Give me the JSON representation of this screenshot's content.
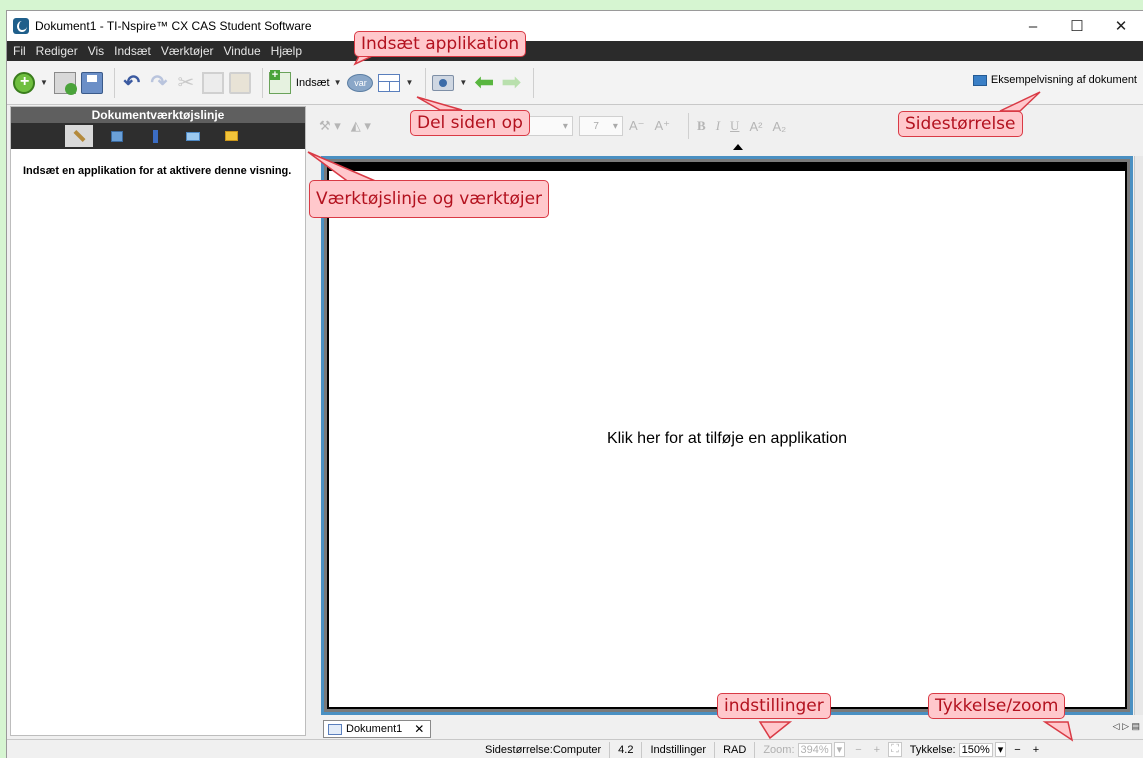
{
  "window": {
    "title": "Dokument1 - TI-Nspire™ CX CAS Student Software",
    "controls": [
      "–",
      "☐",
      "✕"
    ]
  },
  "menu": [
    "Fil",
    "Rediger",
    "Vis",
    "Indsæt",
    "Værktøjer",
    "Vindue",
    "Hjælp"
  ],
  "toolbar": {
    "insert_label": "Indsæt",
    "var_label": "var",
    "preview_label": "Eksempelvisning af dokument"
  },
  "left_panel": {
    "title": "Dokumentværktøjslinje",
    "message": "Indsæt en applikation for at aktivere denne visning.",
    "tabs": [
      "tools-icon",
      "variables-icon",
      "calculator-icon",
      "book-icon",
      "folder-icon"
    ]
  },
  "format_toolbar": {
    "font_size": "7",
    "items": [
      "A⁻",
      "A⁺",
      "B",
      "I",
      "U",
      "A²",
      "A₂"
    ]
  },
  "page": {
    "prompt": "Klik her for at tilføje en applikation"
  },
  "doc_tab": {
    "label": "Dokument1",
    "close": "✕"
  },
  "statusbar": {
    "page_size": "Sidestørrelse:Computer",
    "version": "4.2",
    "settings": "Indstillinger",
    "angle_mode": "RAD",
    "zoom_label": "Zoom:",
    "zoom_value": "394%",
    "thickness_label": "Tykkelse:",
    "thickness_value": "150%",
    "minus": "−",
    "plus": "+"
  },
  "callouts": {
    "insert_app": "Indsæt applikation",
    "split_page": "Del siden op",
    "page_size": "Sidestørrelse",
    "toolbar_tools": "Værktøjslinje og værktøjer",
    "settings": "indstillinger",
    "thickness_zoom": "Tykkelse/zoom"
  },
  "colors": {
    "background": "#d6f5d1",
    "callout_fill": "#ffc8cc",
    "callout_border": "#d93a45",
    "page_frame": "#4a90c2"
  }
}
